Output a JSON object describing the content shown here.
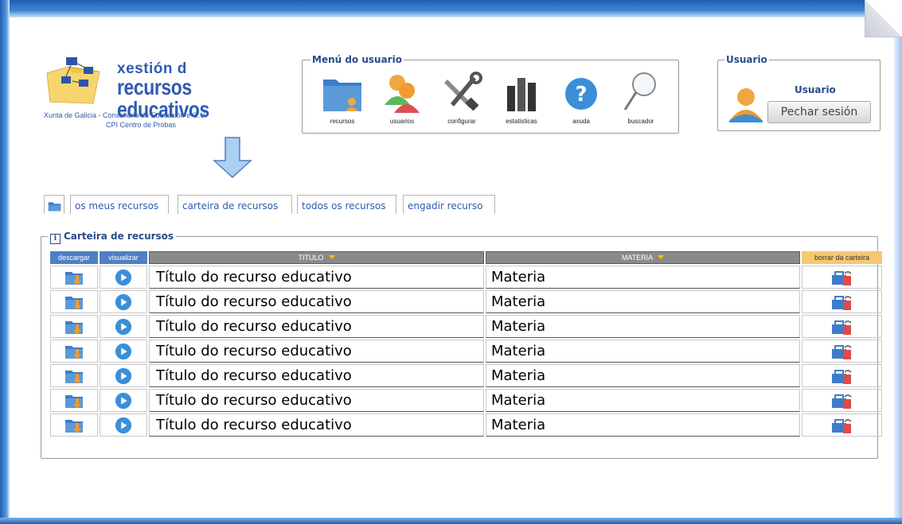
{
  "logo": {
    "line1": "xestión d",
    "line2": "recursos educativos",
    "sub1": "Xunta de Galicia - Consellería de Educación e O.U.",
    "sub2": "CPI Centro de Probas"
  },
  "user_menu": {
    "legend": "Menú do usuario",
    "items": [
      {
        "label": "recursos",
        "icon": "folder-user-icon"
      },
      {
        "label": "usuarios",
        "icon": "users-icon"
      },
      {
        "label": "configurar",
        "icon": "tools-icon"
      },
      {
        "label": "estatisticas",
        "icon": "bar-chart-icon"
      },
      {
        "label": "axuda",
        "icon": "help-icon"
      },
      {
        "label": "buscador",
        "icon": "magnifier-icon"
      }
    ]
  },
  "user_box": {
    "legend": "Usuario",
    "name": "Usuario",
    "logout_label": "Pechar sesión"
  },
  "tabs": [
    {
      "label": "",
      "icon": "folder-icon"
    },
    {
      "label": "os meus recursos"
    },
    {
      "label": "carteira de recursos"
    },
    {
      "label": "todos os recursos"
    },
    {
      "label": "engadir recurso"
    }
  ],
  "resources": {
    "legend": "Carteira de recursos",
    "columns": {
      "download": "descargar",
      "view": "visualizar",
      "title": "TITULO",
      "subject": "MATERIA",
      "remove": "borrar da carteira"
    },
    "rows": [
      {
        "title": "Título do recurso educativo",
        "subject": "Materia"
      },
      {
        "title": "Título do recurso educativo",
        "subject": "Materia"
      },
      {
        "title": "Título do recurso educativo",
        "subject": "Materia"
      },
      {
        "title": "Título do recurso educativo",
        "subject": "Materia"
      },
      {
        "title": "Título do recurso educativo",
        "subject": "Materia"
      },
      {
        "title": "Título do recurso educativo",
        "subject": "Materia"
      },
      {
        "title": "Título do recurso educativo",
        "subject": "Materia"
      }
    ]
  },
  "colors": {
    "accent": "#2f5bb0",
    "header_blue": "#4f7fc4",
    "header_gray": "#8a8a8a",
    "header_orange": "#f5c870"
  }
}
